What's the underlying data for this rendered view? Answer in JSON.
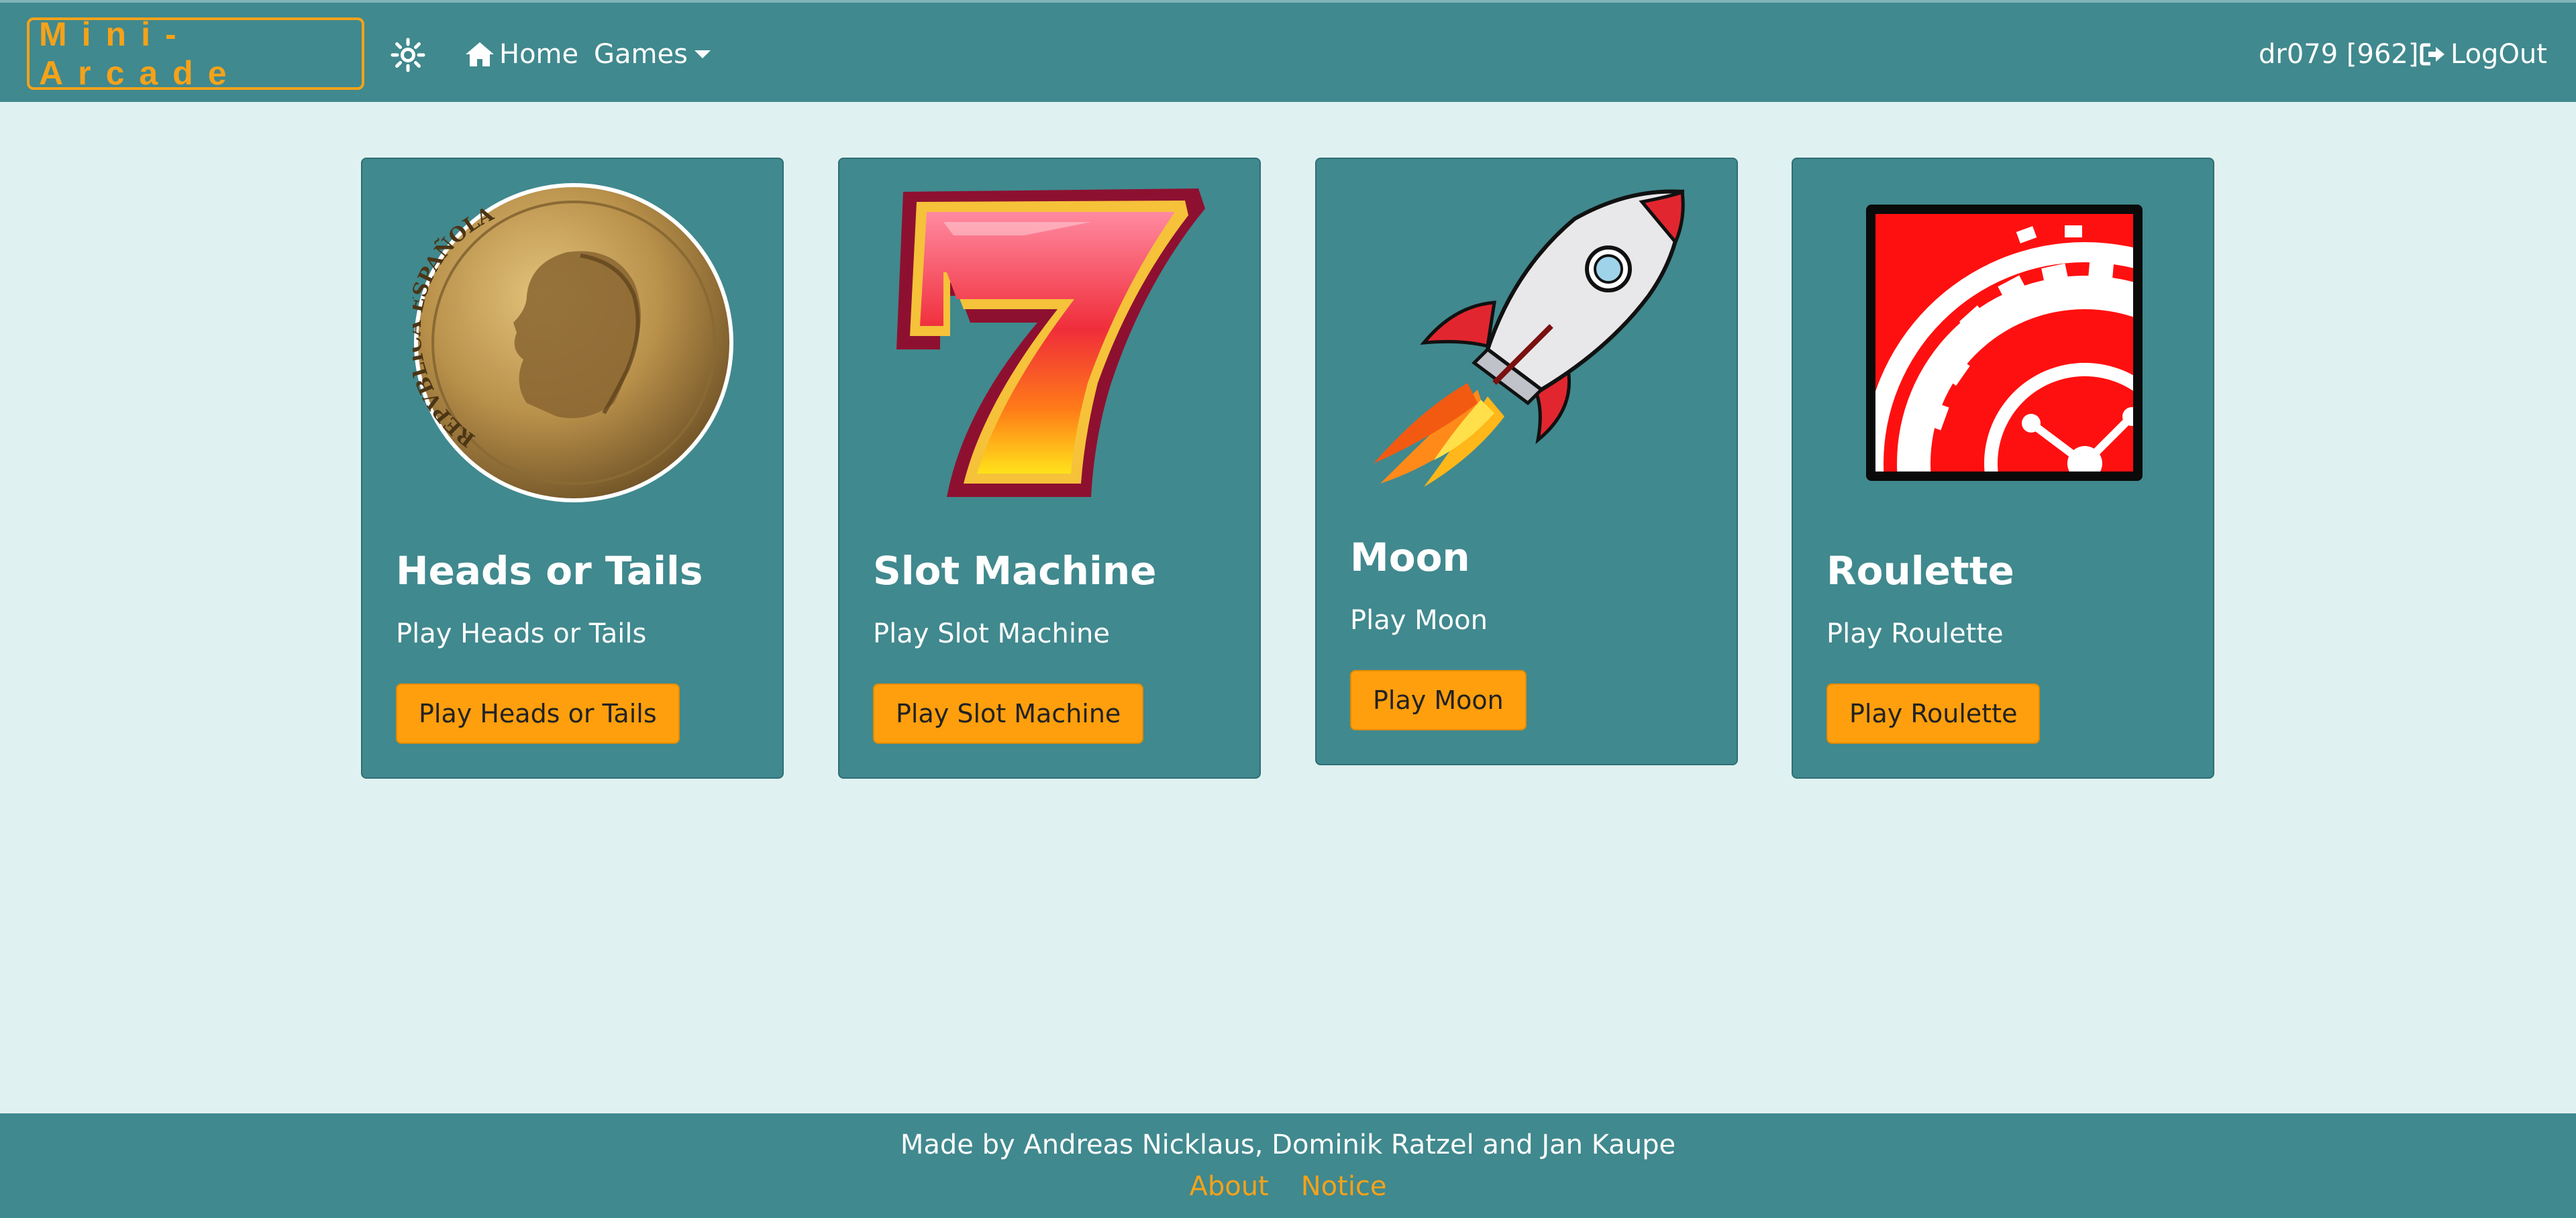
{
  "navbar": {
    "brand": "Mini-Arcade",
    "theme_icon": "sun-icon",
    "home_label": "Home",
    "games_label": "Games",
    "user_label": "dr079 [962]",
    "logout_label": "LogOut"
  },
  "cards": [
    {
      "title": "Heads or Tails",
      "text": "Play Heads or Tails",
      "button": "Play Heads or Tails",
      "image": "coin-image",
      "coin_text": "REPVBLICA ESPAÑOLA"
    },
    {
      "title": "Slot Machine",
      "text": "Play Slot Machine",
      "button": "Play Slot Machine",
      "image": "lucky-seven-image",
      "glyph": "7"
    },
    {
      "title": "Moon",
      "text": "Play Moon",
      "button": "Play Moon",
      "image": "rocket-image"
    },
    {
      "title": "Roulette",
      "text": "Play Roulette",
      "button": "Play Roulette",
      "image": "roulette-wheel-image"
    }
  ],
  "footer": {
    "credit": "Made by Andreas Nicklaus, Dominik Ratzel and Jan Kaupe",
    "about": "About",
    "notice": "Notice"
  },
  "colors": {
    "navbar": "#40898e",
    "page_background": "#e0f1f1",
    "accent": "#ff9f0d",
    "card": "#40898e"
  }
}
